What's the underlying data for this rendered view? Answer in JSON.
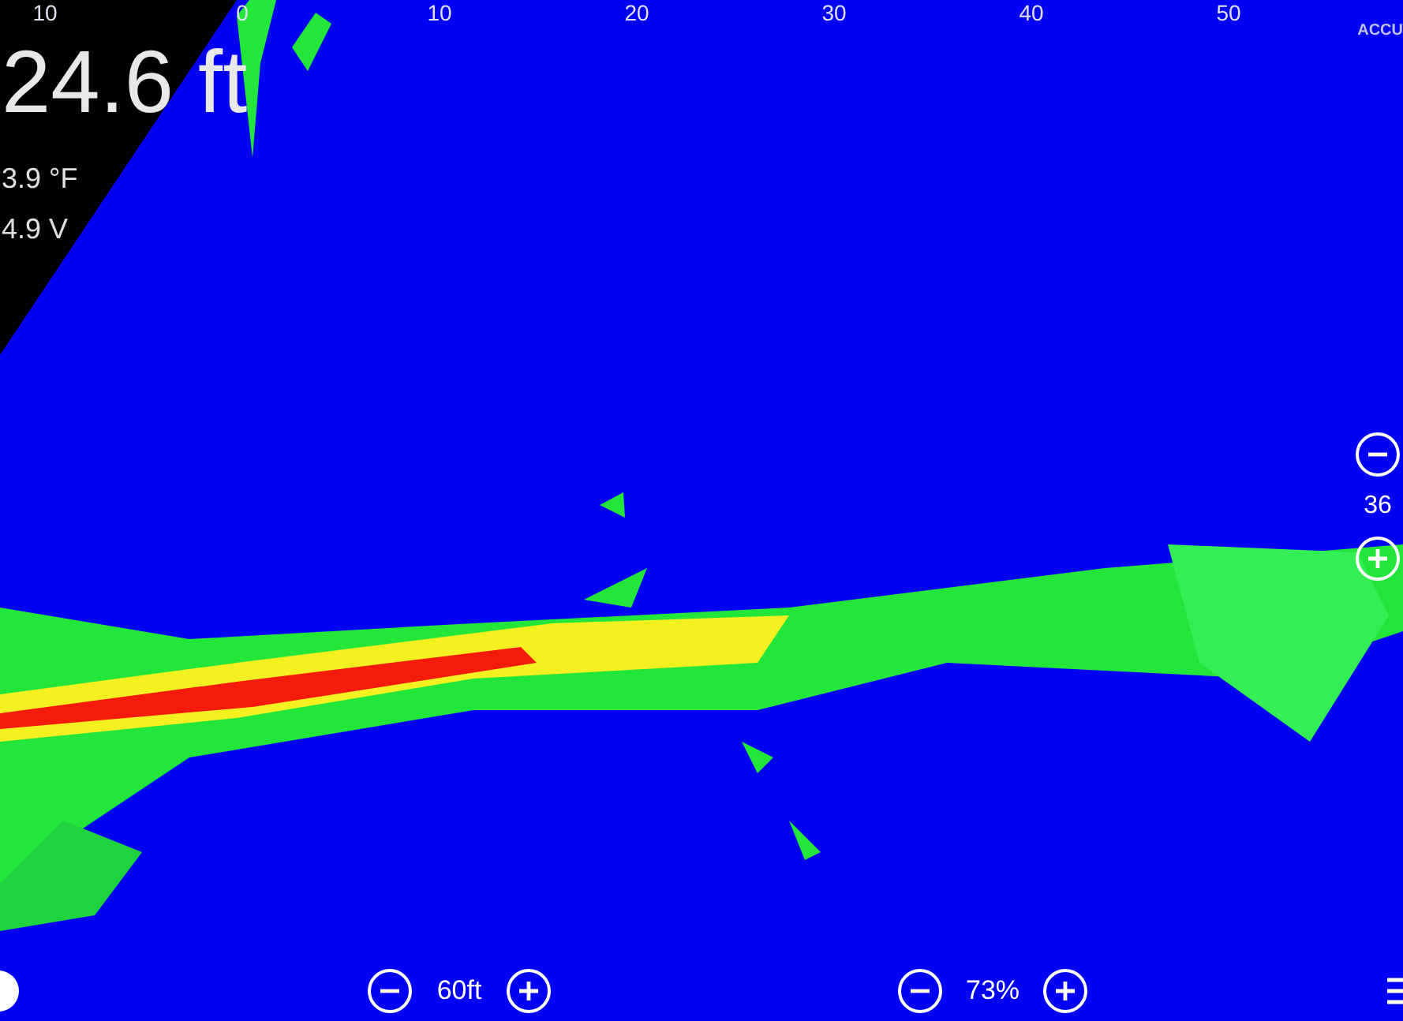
{
  "axis": {
    "ticks": [
      "10",
      "0",
      "10",
      "20",
      "30",
      "40",
      "50"
    ]
  },
  "brand": "ACCU",
  "readout": {
    "depth": "24.6 ft",
    "temperature": "3.9 °F",
    "voltage": "4.9 V"
  },
  "side_control": {
    "value": "36"
  },
  "bottom_controls": [
    {
      "value": "60ft"
    },
    {
      "value": "73%"
    }
  ]
}
